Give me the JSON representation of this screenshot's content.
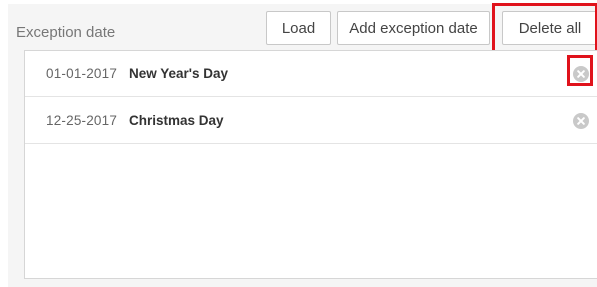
{
  "header": {
    "title": "Exception date",
    "load_label": "Load",
    "add_label": "Add exception date",
    "delete_all_label": "Delete all"
  },
  "exceptions": [
    {
      "date": "01-01-2017",
      "name": "New Year's Day",
      "remove_icon": "close-circle-icon"
    },
    {
      "date": "12-25-2017",
      "name": "Christmas Day",
      "remove_icon": "close-circle-icon"
    }
  ],
  "colors": {
    "highlight": "#e0121b",
    "panel_bg": "#f5f5f5",
    "remove_icon": "#c9c9c9"
  }
}
